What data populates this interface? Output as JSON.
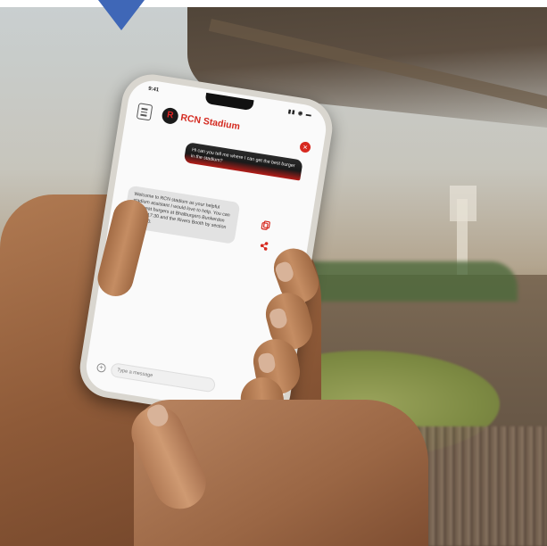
{
  "indicator": {
    "color": "#3f67b7"
  },
  "phone": {
    "status_time": "9:41",
    "status_icons": "▮▮ ◉ ▬",
    "header": {
      "menu_icon": "menu-icon",
      "logo_letter": "R",
      "brand_name": "RCN",
      "brand_suffix": " Stadium",
      "brand_color": "#d42a20"
    },
    "close_icon": "×",
    "messages": [
      {
        "role": "user",
        "text": "Hi can you tell me where I can get the best burger in the stadium?"
      },
      {
        "role": "bot",
        "text": "Welcome to RCN stadium as your helpful stadium assistant I would love to help. You can find great burgers at Bhalburgers Bunkerdon 17:00 - 17:30 and the Rivers Booth by section 400 - 470."
      }
    ],
    "actions": [
      "copy-icon",
      "share-icon"
    ],
    "composer": {
      "placeholder": "Type a message",
      "add_icon": "+",
      "send_icon": "➤"
    }
  }
}
